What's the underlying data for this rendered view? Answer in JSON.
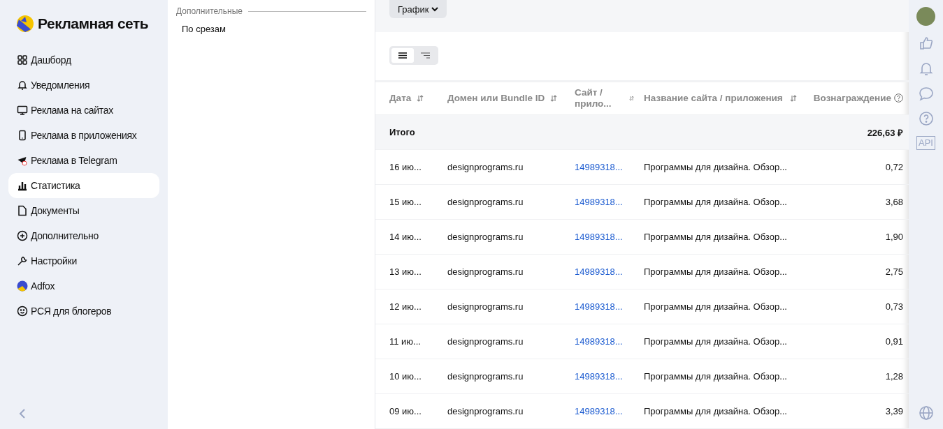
{
  "logo": {
    "title": "Рекламная сеть"
  },
  "sidebar": {
    "items": [
      {
        "label": "Дашборд",
        "selected": false
      },
      {
        "label": "Уведомления",
        "selected": false
      },
      {
        "label": "Реклама на сайтах",
        "selected": false
      },
      {
        "label": "Реклама в приложениях",
        "selected": false
      },
      {
        "label": "Реклама в Telegram",
        "selected": false
      },
      {
        "label": "Статистика",
        "selected": true
      },
      {
        "label": "Документы",
        "selected": false
      },
      {
        "label": "Дополнительно",
        "selected": false
      },
      {
        "label": "Настройки",
        "selected": false
      },
      {
        "label": "Adfox",
        "selected": false
      },
      {
        "label": "РСЯ для блогеров",
        "selected": false
      }
    ]
  },
  "subpanel": {
    "section": "Дополнительные",
    "items": [
      "По срезам"
    ]
  },
  "toolbar": {
    "chart_button": "График",
    "view_toggle": [
      {
        "selected": true
      },
      {
        "selected": false
      }
    ]
  },
  "table": {
    "columns": [
      {
        "label": "Дата",
        "sortable": true
      },
      {
        "label": "Домен или Bundle ID",
        "sortable": true
      },
      {
        "label": "Сайт / прило...",
        "sortable": true
      },
      {
        "label": "Название сайта / приложения",
        "sortable": true
      },
      {
        "label": "Вознаграждение",
        "sortable": false
      }
    ],
    "total": {
      "label": "Итого",
      "value": "226,63 ₽"
    },
    "rows": [
      [
        "16 ию...",
        "designprograms.ru",
        "14989318...",
        "Программы для дизайна. Обзор...",
        "0,72"
      ],
      [
        "15 ию...",
        "designprograms.ru",
        "14989318...",
        "Программы для дизайна. Обзор...",
        "3,68"
      ],
      [
        "14 ию...",
        "designprograms.ru",
        "14989318...",
        "Программы для дизайна. Обзор...",
        "1,90"
      ],
      [
        "13 ию...",
        "designprograms.ru",
        "14989318...",
        "Программы для дизайна. Обзор...",
        "2,75"
      ],
      [
        "12 ию...",
        "designprograms.ru",
        "14989318...",
        "Программы для дизайна. Обзор...",
        "0,73"
      ],
      [
        "11 ию...",
        "designprograms.ru",
        "14989318...",
        "Программы для дизайна. Обзор...",
        "0,91"
      ],
      [
        "10 ию...",
        "designprograms.ru",
        "14989318...",
        "Программы для дизайна. Обзор...",
        "1,28"
      ],
      [
        "09 ию...",
        "designprograms.ru",
        "14989318...",
        "Программы для дизайна. Обзор...",
        "3,39"
      ]
    ]
  },
  "right_rail": {
    "api_label": "API"
  }
}
